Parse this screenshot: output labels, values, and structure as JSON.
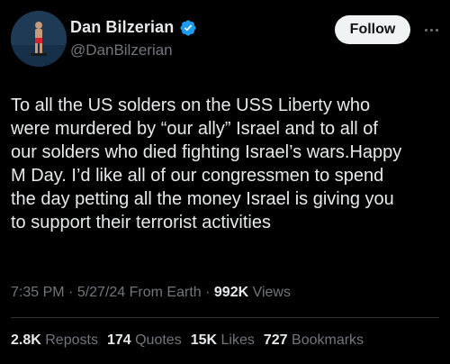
{
  "author": {
    "display_name": "Dan Bilzerian",
    "handle": "@DanBilzerian",
    "verified": true,
    "verified_color": "#1d9bf0"
  },
  "actions": {
    "follow_label": "Follow",
    "more_icon": "more-horizontal-icon"
  },
  "tweet": {
    "text": "To all the US solders on the USS Liberty who\nwere murdered by “our ally” Israel and to all of\nour solders who died fighting Israel’s wars.Happy\nM Day. I’d like all of our congressmen to spend\nthe day petting all the money Israel is giving you\nto support their terrorist activities"
  },
  "meta": {
    "time": "7:35 PM",
    "sep1": " · ",
    "date": "5/27/24",
    "location": " From Earth",
    "sep2": " · ",
    "views_count": "992K",
    "views_label": " Views"
  },
  "stats": [
    {
      "count": "2.8K",
      "label": "Reposts"
    },
    {
      "count": "174",
      "label": "Quotes"
    },
    {
      "count": "15K",
      "label": "Likes"
    },
    {
      "count": "727",
      "label": "Bookmarks"
    }
  ],
  "colors": {
    "background": "#000000",
    "primary_text": "#e7e9ea",
    "secondary_text": "#71767b",
    "divider": "#2f3336",
    "follow_bg": "#eff3f4"
  }
}
